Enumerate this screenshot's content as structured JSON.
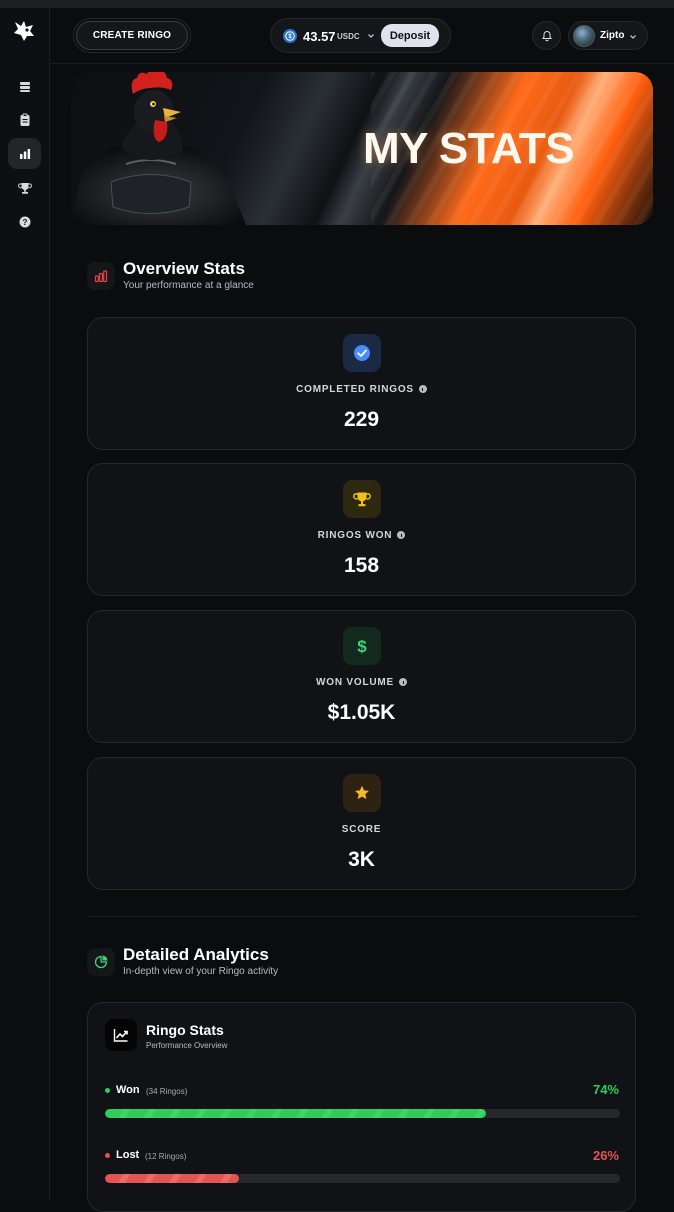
{
  "header": {
    "create_label": "CREATE RINGO",
    "balance": "43.57",
    "currency": "USDC",
    "deposit_label": "Deposit",
    "username": "Zipto"
  },
  "sidebar": {
    "items": [
      {
        "icon": "coins-icon",
        "active": false
      },
      {
        "icon": "clipboard-icon",
        "active": false
      },
      {
        "icon": "bar-chart-icon",
        "active": true
      },
      {
        "icon": "trophy-icon",
        "active": false
      },
      {
        "icon": "help-icon",
        "active": false
      }
    ]
  },
  "banner": {
    "title": "MY STATS"
  },
  "overview": {
    "title": "Overview Stats",
    "subtitle": "Your performance at a glance",
    "cards": [
      {
        "label": "COMPLETED RINGOS",
        "value": "229",
        "icon": "check-badge-icon",
        "color": "#4a8cff",
        "bg": "#1a2a45",
        "info": true
      },
      {
        "label": "RINGOS WON",
        "value": "158",
        "icon": "trophy-icon",
        "color": "#f2c21a",
        "bg": "#2e2810",
        "info": true
      },
      {
        "label": "WON VOLUME",
        "value": "1.05K",
        "prefix": "$",
        "icon": "dollar-icon",
        "color": "#3fd47a",
        "bg": "#12291d",
        "info": true
      },
      {
        "label": "SCORE",
        "value": "3K",
        "icon": "star-icon",
        "color": "#f5b82a",
        "bg": "#2e2312",
        "info": false
      }
    ]
  },
  "analytics": {
    "title": "Detailed Analytics",
    "subtitle": "In-depth view of your Ringo activity",
    "card_title": "Ringo Stats",
    "card_subtitle": "Performance Overview",
    "rows": [
      {
        "label": "Won",
        "count": "(34 Ringos)",
        "percent": "74%",
        "fraction": 0.74,
        "color": "#2ecc5a"
      },
      {
        "label": "Lost",
        "count": "(12 Ringos)",
        "percent": "26%",
        "fraction": 0.26,
        "color": "#e35454"
      }
    ]
  }
}
